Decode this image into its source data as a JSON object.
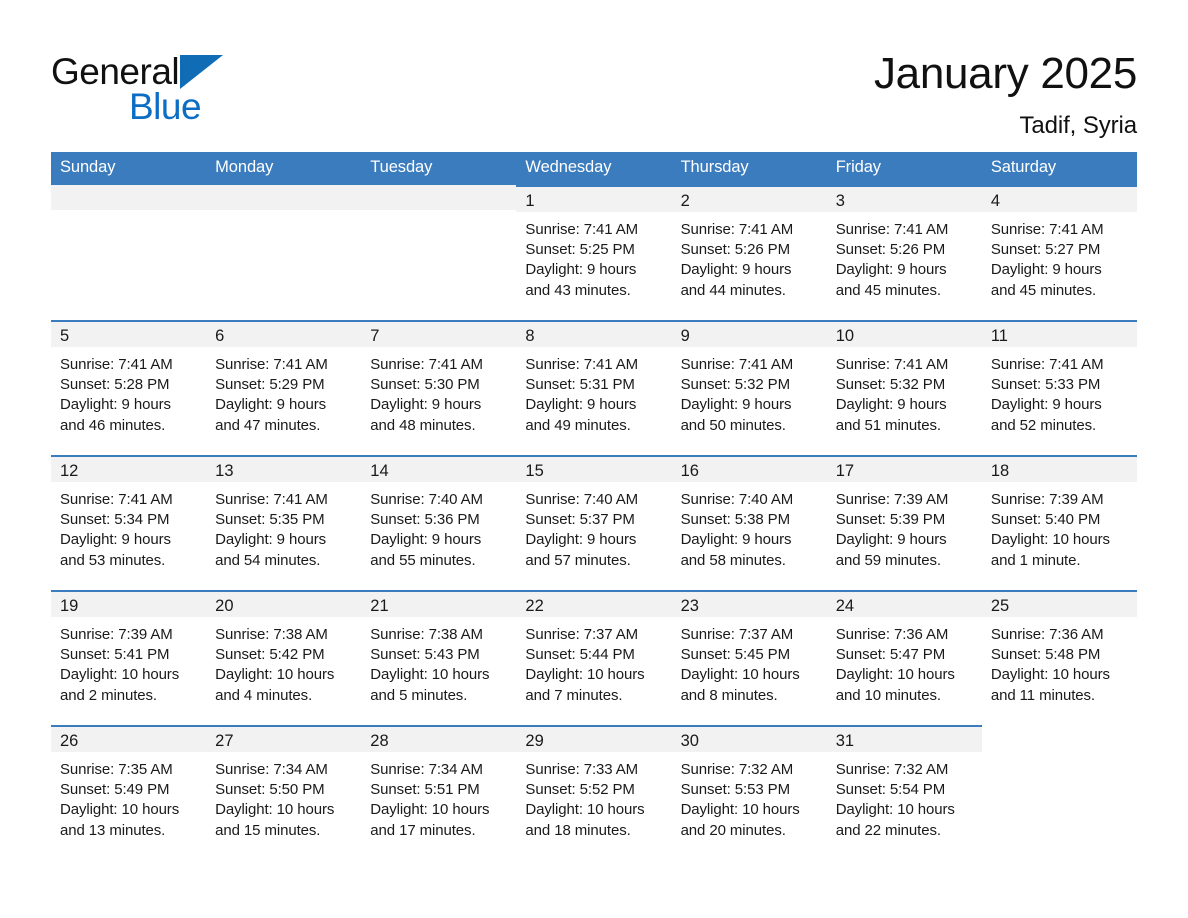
{
  "brand": {
    "name_part1": "General",
    "name_part2": "Blue",
    "triangle_color": "#0f6cb5",
    "blue_text_color": "#0b6ec4"
  },
  "header": {
    "title": "January 2025",
    "location": "Tadif, Syria"
  },
  "theme": {
    "header_blue": "#3b7cbe",
    "daynum_band": "#f2f2f2",
    "text": "#1a1a1a"
  },
  "calendar": {
    "weekday_headers": [
      "Sunday",
      "Monday",
      "Tuesday",
      "Wednesday",
      "Thursday",
      "Friday",
      "Saturday"
    ],
    "weeks": [
      [
        {
          "blank": true
        },
        {
          "blank": true
        },
        {
          "blank": true
        },
        {
          "day": "1",
          "sunrise": "Sunrise: 7:41 AM",
          "sunset": "Sunset: 5:25 PM",
          "daylight_line1": "Daylight: 9 hours",
          "daylight_line2": "and 43 minutes."
        },
        {
          "day": "2",
          "sunrise": "Sunrise: 7:41 AM",
          "sunset": "Sunset: 5:26 PM",
          "daylight_line1": "Daylight: 9 hours",
          "daylight_line2": "and 44 minutes."
        },
        {
          "day": "3",
          "sunrise": "Sunrise: 7:41 AM",
          "sunset": "Sunset: 5:26 PM",
          "daylight_line1": "Daylight: 9 hours",
          "daylight_line2": "and 45 minutes."
        },
        {
          "day": "4",
          "sunrise": "Sunrise: 7:41 AM",
          "sunset": "Sunset: 5:27 PM",
          "daylight_line1": "Daylight: 9 hours",
          "daylight_line2": "and 45 minutes."
        }
      ],
      [
        {
          "day": "5",
          "sunrise": "Sunrise: 7:41 AM",
          "sunset": "Sunset: 5:28 PM",
          "daylight_line1": "Daylight: 9 hours",
          "daylight_line2": "and 46 minutes."
        },
        {
          "day": "6",
          "sunrise": "Sunrise: 7:41 AM",
          "sunset": "Sunset: 5:29 PM",
          "daylight_line1": "Daylight: 9 hours",
          "daylight_line2": "and 47 minutes."
        },
        {
          "day": "7",
          "sunrise": "Sunrise: 7:41 AM",
          "sunset": "Sunset: 5:30 PM",
          "daylight_line1": "Daylight: 9 hours",
          "daylight_line2": "and 48 minutes."
        },
        {
          "day": "8",
          "sunrise": "Sunrise: 7:41 AM",
          "sunset": "Sunset: 5:31 PM",
          "daylight_line1": "Daylight: 9 hours",
          "daylight_line2": "and 49 minutes."
        },
        {
          "day": "9",
          "sunrise": "Sunrise: 7:41 AM",
          "sunset": "Sunset: 5:32 PM",
          "daylight_line1": "Daylight: 9 hours",
          "daylight_line2": "and 50 minutes."
        },
        {
          "day": "10",
          "sunrise": "Sunrise: 7:41 AM",
          "sunset": "Sunset: 5:32 PM",
          "daylight_line1": "Daylight: 9 hours",
          "daylight_line2": "and 51 minutes."
        },
        {
          "day": "11",
          "sunrise": "Sunrise: 7:41 AM",
          "sunset": "Sunset: 5:33 PM",
          "daylight_line1": "Daylight: 9 hours",
          "daylight_line2": "and 52 minutes."
        }
      ],
      [
        {
          "day": "12",
          "sunrise": "Sunrise: 7:41 AM",
          "sunset": "Sunset: 5:34 PM",
          "daylight_line1": "Daylight: 9 hours",
          "daylight_line2": "and 53 minutes."
        },
        {
          "day": "13",
          "sunrise": "Sunrise: 7:41 AM",
          "sunset": "Sunset: 5:35 PM",
          "daylight_line1": "Daylight: 9 hours",
          "daylight_line2": "and 54 minutes."
        },
        {
          "day": "14",
          "sunrise": "Sunrise: 7:40 AM",
          "sunset": "Sunset: 5:36 PM",
          "daylight_line1": "Daylight: 9 hours",
          "daylight_line2": "and 55 minutes."
        },
        {
          "day": "15",
          "sunrise": "Sunrise: 7:40 AM",
          "sunset": "Sunset: 5:37 PM",
          "daylight_line1": "Daylight: 9 hours",
          "daylight_line2": "and 57 minutes."
        },
        {
          "day": "16",
          "sunrise": "Sunrise: 7:40 AM",
          "sunset": "Sunset: 5:38 PM",
          "daylight_line1": "Daylight: 9 hours",
          "daylight_line2": "and 58 minutes."
        },
        {
          "day": "17",
          "sunrise": "Sunrise: 7:39 AM",
          "sunset": "Sunset: 5:39 PM",
          "daylight_line1": "Daylight: 9 hours",
          "daylight_line2": "and 59 minutes."
        },
        {
          "day": "18",
          "sunrise": "Sunrise: 7:39 AM",
          "sunset": "Sunset: 5:40 PM",
          "daylight_line1": "Daylight: 10 hours",
          "daylight_line2": "and 1 minute."
        }
      ],
      [
        {
          "day": "19",
          "sunrise": "Sunrise: 7:39 AM",
          "sunset": "Sunset: 5:41 PM",
          "daylight_line1": "Daylight: 10 hours",
          "daylight_line2": "and 2 minutes."
        },
        {
          "day": "20",
          "sunrise": "Sunrise: 7:38 AM",
          "sunset": "Sunset: 5:42 PM",
          "daylight_line1": "Daylight: 10 hours",
          "daylight_line2": "and 4 minutes."
        },
        {
          "day": "21",
          "sunrise": "Sunrise: 7:38 AM",
          "sunset": "Sunset: 5:43 PM",
          "daylight_line1": "Daylight: 10 hours",
          "daylight_line2": "and 5 minutes."
        },
        {
          "day": "22",
          "sunrise": "Sunrise: 7:37 AM",
          "sunset": "Sunset: 5:44 PM",
          "daylight_line1": "Daylight: 10 hours",
          "daylight_line2": "and 7 minutes."
        },
        {
          "day": "23",
          "sunrise": "Sunrise: 7:37 AM",
          "sunset": "Sunset: 5:45 PM",
          "daylight_line1": "Daylight: 10 hours",
          "daylight_line2": "and 8 minutes."
        },
        {
          "day": "24",
          "sunrise": "Sunrise: 7:36 AM",
          "sunset": "Sunset: 5:47 PM",
          "daylight_line1": "Daylight: 10 hours",
          "daylight_line2": "and 10 minutes."
        },
        {
          "day": "25",
          "sunrise": "Sunrise: 7:36 AM",
          "sunset": "Sunset: 5:48 PM",
          "daylight_line1": "Daylight: 10 hours",
          "daylight_line2": "and 11 minutes."
        }
      ],
      [
        {
          "day": "26",
          "sunrise": "Sunrise: 7:35 AM",
          "sunset": "Sunset: 5:49 PM",
          "daylight_line1": "Daylight: 10 hours",
          "daylight_line2": "and 13 minutes."
        },
        {
          "day": "27",
          "sunrise": "Sunrise: 7:34 AM",
          "sunset": "Sunset: 5:50 PM",
          "daylight_line1": "Daylight: 10 hours",
          "daylight_line2": "and 15 minutes."
        },
        {
          "day": "28",
          "sunrise": "Sunrise: 7:34 AM",
          "sunset": "Sunset: 5:51 PM",
          "daylight_line1": "Daylight: 10 hours",
          "daylight_line2": "and 17 minutes."
        },
        {
          "day": "29",
          "sunrise": "Sunrise: 7:33 AM",
          "sunset": "Sunset: 5:52 PM",
          "daylight_line1": "Daylight: 10 hours",
          "daylight_line2": "and 18 minutes."
        },
        {
          "day": "30",
          "sunrise": "Sunrise: 7:32 AM",
          "sunset": "Sunset: 5:53 PM",
          "daylight_line1": "Daylight: 10 hours",
          "daylight_line2": "and 20 minutes."
        },
        {
          "day": "31",
          "sunrise": "Sunrise: 7:32 AM",
          "sunset": "Sunset: 5:54 PM",
          "daylight_line1": "Daylight: 10 hours",
          "daylight_line2": "and 22 minutes."
        },
        {
          "blank": true
        }
      ]
    ]
  }
}
